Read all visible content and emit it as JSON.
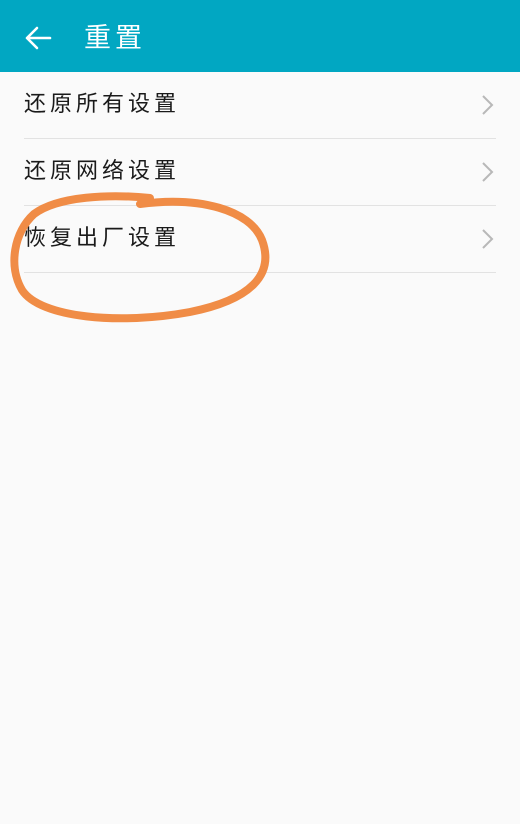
{
  "header": {
    "title": "重置",
    "back_icon": "back-arrow-icon",
    "background_color": "#01a7c2"
  },
  "list": {
    "items": [
      {
        "label": "还原所有设置",
        "icon": "chevron-right-icon"
      },
      {
        "label": "还原网络设置",
        "icon": "chevron-right-icon"
      },
      {
        "label": "恢复出厂设置",
        "icon": "chevron-right-icon"
      }
    ]
  },
  "annotation": {
    "shape": "hand-drawn-ellipse",
    "color": "#f08c46",
    "highlights": "恢复出厂设置"
  }
}
